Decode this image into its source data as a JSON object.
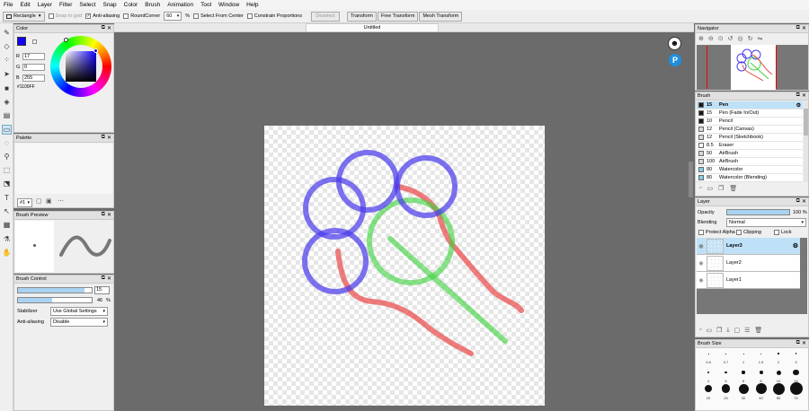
{
  "menu": [
    "File",
    "Edit",
    "Layer",
    "Filter",
    "Select",
    "Snap",
    "Color",
    "Brush",
    "Animation",
    "Tool",
    "Window",
    "Help"
  ],
  "toolbar": {
    "shape": "Rectangle",
    "snap_to_grid": "Snap to grid",
    "anti_aliasing": "Anti-aliasing",
    "round_corner": "RoundCorner",
    "round_value": "60",
    "percent": "%",
    "select_from_center": "Select From Center",
    "constrain": "Constrain Proportions",
    "deselect": "Deselect",
    "transform": "Transform",
    "free_transform": "Free Transform",
    "mesh_transform": "Mesh Transform"
  },
  "doc_tab": "Untitled",
  "color_panel": {
    "title": "Color",
    "r_label": "R",
    "r": "17",
    "g_label": "G",
    "g": "0",
    "b_label": "B",
    "b": "255",
    "hex": "#1100FF",
    "fg_color": "#1100ff"
  },
  "palette": {
    "title": "Palette",
    "num": "#1"
  },
  "brush_preview": {
    "title": "Brush Preview"
  },
  "brush_control": {
    "title": "Brush Control",
    "size": "15",
    "opacity": "46",
    "opacity_unit": "%",
    "size_fill": 0.9,
    "opacity_fill": 0.46,
    "stabilizer_label": "Stabilizer",
    "stabilizer": "Use Global Settings",
    "aa_label": "Anti-aliasing",
    "aa": "Disable"
  },
  "navigator": {
    "title": "Navigator"
  },
  "brush_panel": {
    "title": "Brush",
    "items": [
      {
        "size": "15",
        "name": "Pen",
        "color": "#1a1a1a"
      },
      {
        "size": "15",
        "name": "Pen (Fade In/Out)",
        "color": "#1a1a1a"
      },
      {
        "size": "10",
        "name": "Pencil",
        "color": "#1a1a1a"
      },
      {
        "size": "12",
        "name": "Pencil (Canvas)",
        "color": "#d9d9d9"
      },
      {
        "size": "12",
        "name": "Pencil (Sketchbook)",
        "color": "#d9d9d9"
      },
      {
        "size": "8.5",
        "name": "Eraser",
        "color": "#ffffff"
      },
      {
        "size": "50",
        "name": "AirBrush",
        "color": "#d9d9d9"
      },
      {
        "size": "100",
        "name": "AirBrush",
        "color": "#d9d9d9"
      },
      {
        "size": "80",
        "name": "Watercolor",
        "color": "#7fd0ee"
      },
      {
        "size": "80",
        "name": "Watercolor (Blending)",
        "color": "#7fd0ee"
      }
    ]
  },
  "layer_panel": {
    "title": "Layer",
    "opacity_label": "Opacity",
    "opacity": "100 %",
    "blending_label": "Blending",
    "blending": "Normal",
    "protect_alpha": "Protect Alpha",
    "clipping": "Clipping",
    "lock": "Lock",
    "layers": [
      "Layer3",
      "Layer2",
      "Layer1"
    ]
  },
  "brush_size": {
    "title": "Brush Size",
    "row1": [
      "0.8",
      "0.7",
      "1",
      "1.5",
      "2",
      "3"
    ],
    "row2": [
      "4",
      "5",
      "6",
      "8",
      "10",
      "15"
    ],
    "row3": [
      "20",
      "25",
      "30",
      "40",
      "50",
      "70"
    ]
  }
}
